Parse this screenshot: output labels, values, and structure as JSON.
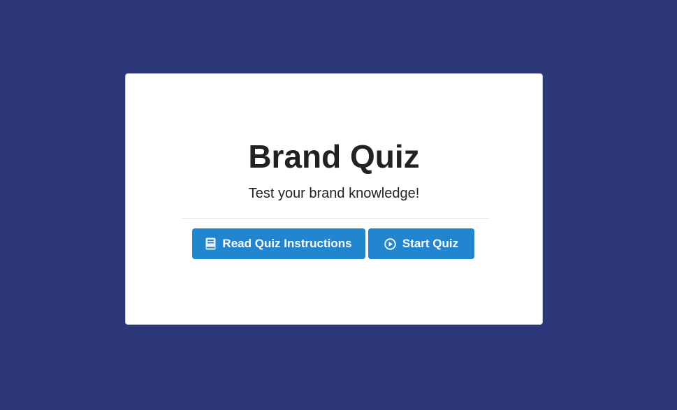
{
  "quiz": {
    "title": "Brand Quiz",
    "subtitle": "Test your brand knowledge!"
  },
  "actions": {
    "instructions_label": "Read Quiz Instructions",
    "instructions_icon": "book-icon",
    "start_label": "Start Quiz",
    "start_icon": "play-circle-icon"
  },
  "colors": {
    "background": "#2d387b",
    "card": "#ffffff",
    "button": "#2185d0",
    "text": "#222222"
  }
}
